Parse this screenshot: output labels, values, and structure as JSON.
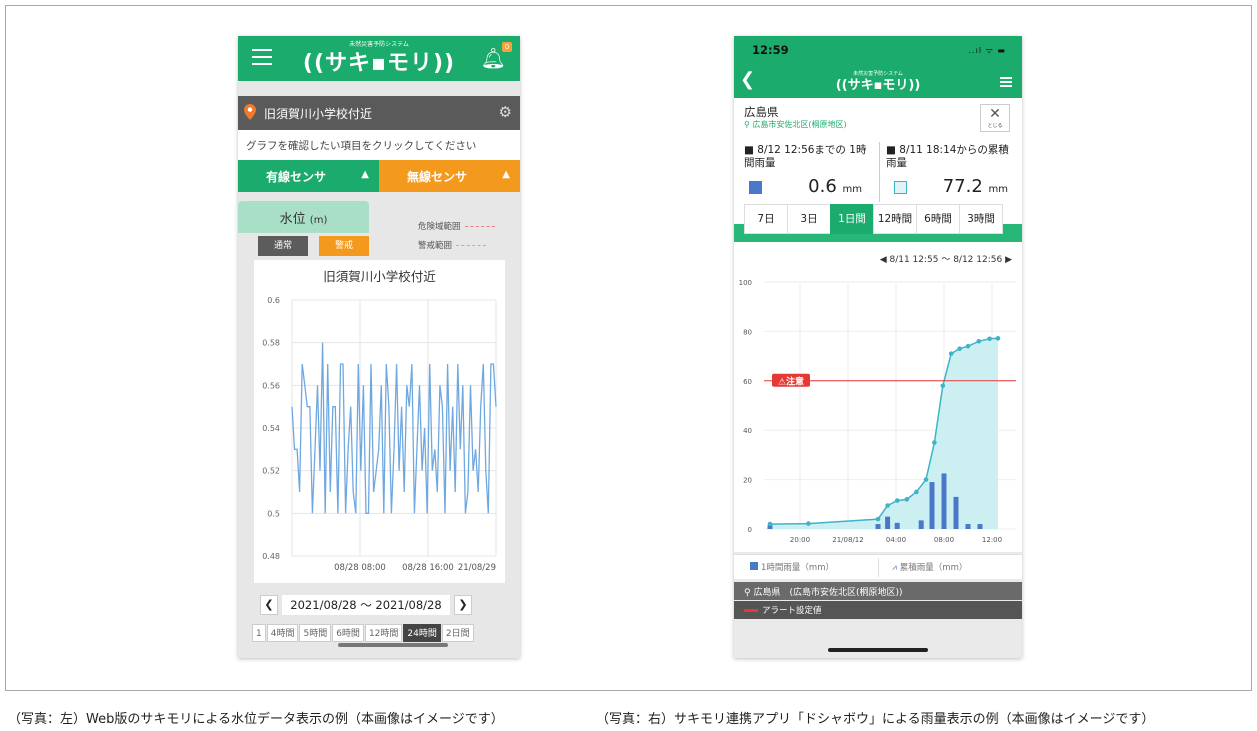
{
  "captions": {
    "left": "（写真：左）Web版のサキモリによる水位データ表示の例（本画像はイメージです）",
    "right": "（写真：右）サキモリ連携アプリ「ドシャボウ」による雨量表示の例（本画像はイメージです）"
  },
  "left_app": {
    "logo_subtitle": "未然災害予防システム",
    "logo": "((サキ▪モリ))",
    "notification_count": "0",
    "location_name": "旧須賀川小学校付近",
    "prompt": "グラフを確認したい項目をクリックしてください",
    "wired_sensor": "有線センサ",
    "wireless_sensor": "無線センサ",
    "tab_label": "水位",
    "tab_unit": "(m)",
    "legend_danger": "危険域範囲",
    "legend_warning": "警戒範囲",
    "btn_normal": "通常",
    "btn_warning": "警戒",
    "date_range": "2021/08/28 〜 2021/08/28",
    "periods": [
      "1",
      "4時間",
      "5時間",
      "6時間",
      "12時間",
      "24時間",
      "2日間"
    ],
    "active_period": "24時間"
  },
  "right_app": {
    "status_time": "12:59",
    "status_icons": "..ıl ᯤ ▬",
    "logo_subtitle": "未然災害予防システム",
    "logo": "((サキ▪モリ))",
    "prefecture": "広島県",
    "area": "広島市安佐北区(桐原地区)",
    "close_label": "とじる",
    "stat1_label": "■ 8/12 12:56までの 1時間雨量",
    "stat1_value": "0.6",
    "stat1_unit": "mm",
    "stat2_label": "■ 8/11 18:14からの累積雨量",
    "stat2_value": "77.2",
    "stat2_unit": "mm",
    "tabs": [
      "7日",
      "3日",
      "1日間",
      "12時間",
      "6時間",
      "3時間"
    ],
    "active_tab": "1日間",
    "chart_range": "◀ 8/11 12:55 〜 8/12 12:56 ▶",
    "alert_label": "⚠注意",
    "legend_hourly": "1時間雨量（mm）",
    "legend_cumulative": "累積雨量（mm）",
    "location_bar": "広島県　(広島市安佐北区(桐原地区))",
    "alert_bar": "アラート設定値"
  },
  "colors": {
    "brand_green": "#1bab6c",
    "orange": "#f39a1e",
    "level_line": "#6fa8e0",
    "rain_bar": "#4a78c9",
    "cumulative_line": "#3fb3c7",
    "cumulative_fill": "#ccf0f2",
    "alert_red": "#e53935"
  },
  "chart_data": [
    {
      "type": "line",
      "title": "旧須賀川小学校付近",
      "ylim": [
        0.48,
        0.6
      ],
      "yticks": [
        "0.48",
        "0.5",
        "0.52",
        "0.54",
        "0.56",
        "0.58",
        "0.6"
      ],
      "xticks": [
        "08/28 08:00",
        "08/28 16:00",
        "21/08/29"
      ],
      "xtick_positions": [
        8,
        16,
        24
      ],
      "xlim": [
        0,
        24
      ],
      "grid": true,
      "series": [
        {
          "x": [
            0,
            0.3,
            0.6,
            0.9,
            1.2,
            1.5,
            1.8,
            2.1,
            2.4,
            2.7,
            3.0,
            3.3,
            3.6,
            3.9,
            4.2,
            4.5,
            4.8,
            5.1,
            5.4,
            5.7,
            6.0,
            6.3,
            6.6,
            6.9,
            7.2,
            7.5,
            7.8,
            8.1,
            8.4,
            8.7,
            9.0,
            9.3,
            9.6,
            9.9,
            10.2,
            10.5,
            10.8,
            11.1,
            11.4,
            11.7,
            12.0,
            12.3,
            12.6,
            12.9,
            13.2,
            13.5,
            13.8,
            14.1,
            14.4,
            14.7,
            15.0,
            15.3,
            15.6,
            15.9,
            16.2,
            16.5,
            16.8,
            17.1,
            17.4,
            17.7,
            18.0,
            18.3,
            18.6,
            18.9,
            19.2,
            19.5,
            19.8,
            20.1,
            20.4,
            20.7,
            21.0,
            21.3,
            21.6,
            21.9,
            22.2,
            22.5,
            22.8,
            23.1,
            23.4,
            23.7,
            24.0
          ],
          "values": [
            0.55,
            0.53,
            0.53,
            0.51,
            0.57,
            0.56,
            0.55,
            0.55,
            0.5,
            0.53,
            0.56,
            0.52,
            0.58,
            0.5,
            0.57,
            0.51,
            0.55,
            0.55,
            0.5,
            0.57,
            0.57,
            0.5,
            0.53,
            0.55,
            0.51,
            0.5,
            0.57,
            0.52,
            0.56,
            0.5,
            0.5,
            0.57,
            0.51,
            0.52,
            0.53,
            0.56,
            0.5,
            0.57,
            0.55,
            0.5,
            0.53,
            0.57,
            0.52,
            0.55,
            0.51,
            0.56,
            0.55,
            0.57,
            0.5,
            0.53,
            0.56,
            0.52,
            0.54,
            0.5,
            0.57,
            0.52,
            0.53,
            0.51,
            0.56,
            0.55,
            0.5,
            0.57,
            0.52,
            0.55,
            0.51,
            0.57,
            0.53,
            0.56,
            0.5,
            0.51,
            0.56,
            0.52,
            0.53,
            0.51,
            0.55,
            0.57,
            0.52,
            0.5,
            0.57,
            0.57,
            0.55
          ]
        }
      ]
    },
    {
      "type": "bar",
      "ylim": [
        0,
        100
      ],
      "yticks": [
        "0",
        "20",
        "40",
        "60",
        "80",
        "100"
      ],
      "xticks": [
        "20:00",
        "21/08/12",
        "04:00",
        "08:00",
        "12:00"
      ],
      "xtick_hours": [
        20,
        24,
        28,
        32,
        36
      ],
      "xlim_hours": [
        17,
        38
      ],
      "alert_threshold": 60,
      "series": [
        {
          "name": "1時間雨量（mm）",
          "type": "bar",
          "hours": [
            17.5,
            26.5,
            27.3,
            28.1,
            30.1,
            31.0,
            32.0,
            33.0,
            34.0,
            35.0
          ],
          "values": [
            1.5,
            2,
            5,
            2.5,
            3.5,
            19,
            22.5,
            13,
            2,
            2
          ]
        },
        {
          "name": "累積雨量（mm）",
          "type": "area",
          "hours": [
            17.5,
            20.7,
            26.5,
            27.3,
            28.1,
            28.9,
            29.7,
            30.5,
            31.2,
            31.9,
            32.6,
            33.3,
            34.0,
            34.9,
            35.8,
            36.5
          ],
          "values": [
            2,
            2.2,
            4,
            9.5,
            11.5,
            12,
            15,
            20,
            35,
            58,
            71,
            73,
            74,
            76,
            77,
            77.2
          ]
        }
      ]
    }
  ]
}
